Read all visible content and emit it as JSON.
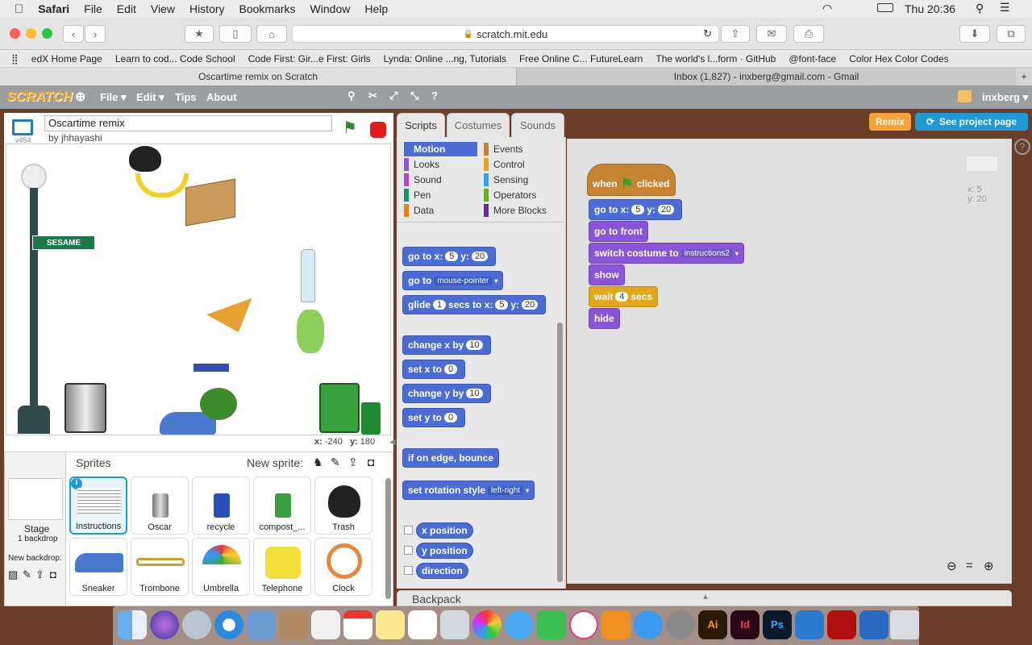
{
  "menubar": {
    "app": "Safari",
    "items": [
      "File",
      "Edit",
      "View",
      "History",
      "Bookmarks",
      "Window",
      "Help"
    ],
    "clock": "Thu 20:36"
  },
  "browser": {
    "url": "scratch.mit.edu",
    "bookmarks": [
      "edX Home Page",
      "Learn to cod... Code School",
      "Code First: Gir...e First: Girls",
      "Lynda: Online ...ng, Tutorials",
      "Free Online C... FutureLearn",
      "The world's l...form · GitHub",
      "@font-face",
      "Color Hex Color Codes"
    ],
    "tabs": [
      "Oscartime remix on Scratch",
      "Inbox (1,827) - inxberg@gmail.com - Gmail"
    ]
  },
  "scratch": {
    "logo": "SCRATCH",
    "menu": [
      "File ▾",
      "Edit ▾",
      "Tips",
      "About"
    ],
    "user": "inxberg ▾",
    "remix_label": "Remix",
    "see_project_label": "See project page"
  },
  "project": {
    "title": "Oscartime remix",
    "author": "by jhhayashi",
    "version": "v454",
    "stage_sign": "SESAME STREET"
  },
  "stage_coords": {
    "x_label": "x:",
    "x": "-240",
    "y_label": "y:",
    "y": "180"
  },
  "editor_tabs": [
    "Scripts",
    "Costumes",
    "Sounds"
  ],
  "categories": [
    {
      "name": "Motion",
      "color": "#4a6cd4"
    },
    {
      "name": "Events",
      "color": "#c88330"
    },
    {
      "name": "Looks",
      "color": "#8a55d7"
    },
    {
      "name": "Control",
      "color": "#e1a91a"
    },
    {
      "name": "Sound",
      "color": "#bb42c3"
    },
    {
      "name": "Sensing",
      "color": "#2ca5e2"
    },
    {
      "name": "Pen",
      "color": "#0e9a6c"
    },
    {
      "name": "Operators",
      "color": "#5cb712"
    },
    {
      "name": "Data",
      "color": "#ee7d16"
    },
    {
      "name": "More Blocks",
      "color": "#632d99"
    }
  ],
  "palette": {
    "goto_xy": {
      "a": "go to x:",
      "x": "5",
      "b": "y:",
      "y": "20"
    },
    "goto": {
      "a": "go to",
      "opt": "mouse-pointer"
    },
    "glide": {
      "a": "glide",
      "s": "1",
      "b": "secs to x:",
      "x": "5",
      "c": "y:",
      "y": "20"
    },
    "change_x": {
      "a": "change x by",
      "v": "10"
    },
    "set_x": {
      "a": "set x to",
      "v": "0"
    },
    "change_y": {
      "a": "change y by",
      "v": "10"
    },
    "set_y": {
      "a": "set y to",
      "v": "0"
    },
    "bounce": "if on edge, bounce",
    "rot": {
      "a": "set rotation style",
      "opt": "left-right"
    },
    "rep": [
      "x position",
      "y position",
      "direction"
    ]
  },
  "script": {
    "hat": {
      "a": "when",
      "b": "clicked"
    },
    "goto": {
      "a": "go to x:",
      "x": "5",
      "b": "y:",
      "y": "20"
    },
    "front": "go to front",
    "costume": {
      "a": "switch costume to",
      "opt": "instructions2"
    },
    "show": "show",
    "wait": {
      "a": "wait",
      "v": "4",
      "b": "secs"
    },
    "hide": "hide"
  },
  "sprite_coords": {
    "x": "x: 5",
    "y": "y: 20"
  },
  "sprites": {
    "header": "Sprites",
    "new_sprite": "New sprite:",
    "stage_label": "Stage",
    "stage_backdrops": "1 backdrop",
    "new_backdrop": "New backdrop:",
    "list": [
      "Instructions",
      "Oscar",
      "recycle",
      "compost_...",
      "Trash",
      "Sneaker",
      "Trombone",
      "Umbrella",
      "Telephone",
      "Clock"
    ]
  },
  "backpack": "Backpack"
}
